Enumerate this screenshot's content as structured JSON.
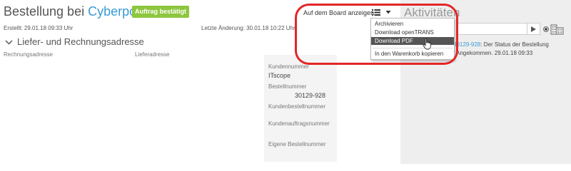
{
  "order": {
    "title_prefix": "Bestellung bei",
    "supplier": "Cyberport",
    "status_badge": "Auftrag bestätigt",
    "created": "Erstellt: 29.01.18 09:33 Uhr",
    "changed": "Letzte Änderung: 30.01.18 10:22 Uhr"
  },
  "address_section": {
    "title": "Liefer- und Rechnungsadresse",
    "billing_label": "Rechnungsadresse",
    "shipping_label": "Lieferadresse"
  },
  "info": {
    "customer_number_label": "Kundennummer",
    "customer_name": "ITscope",
    "order_number_label": "Bestellnummer",
    "order_number": "30129-928",
    "customer_order_number_label": "Kundenbestellnummer",
    "customer_job_number_label": "Kundenauftragsnummer",
    "own_order_number_label": "Eigene Bestellnummer"
  },
  "board": {
    "label": "Auf dem Board anzeigen",
    "icon": "list-icon",
    "caret_icon": "caret-down-icon"
  },
  "menu": {
    "items": [
      "Archivieren",
      "Download openTRANS",
      "Download PDF",
      "In den Warenkorb kopieren"
    ],
    "active_index": 2
  },
  "activities": {
    "title": "Aktivitäten",
    "input_value": "",
    "send_icon": "play-icon",
    "entry_id": "30129-928",
    "entry_text_1": ": Der Status der Bestellung",
    "entry_text_2": "f Angekommen. 29.01.18 09:33"
  },
  "highlight_color": "#e32626",
  "accent_color": "#3a9bd5",
  "badge_color": "#8dc63f"
}
